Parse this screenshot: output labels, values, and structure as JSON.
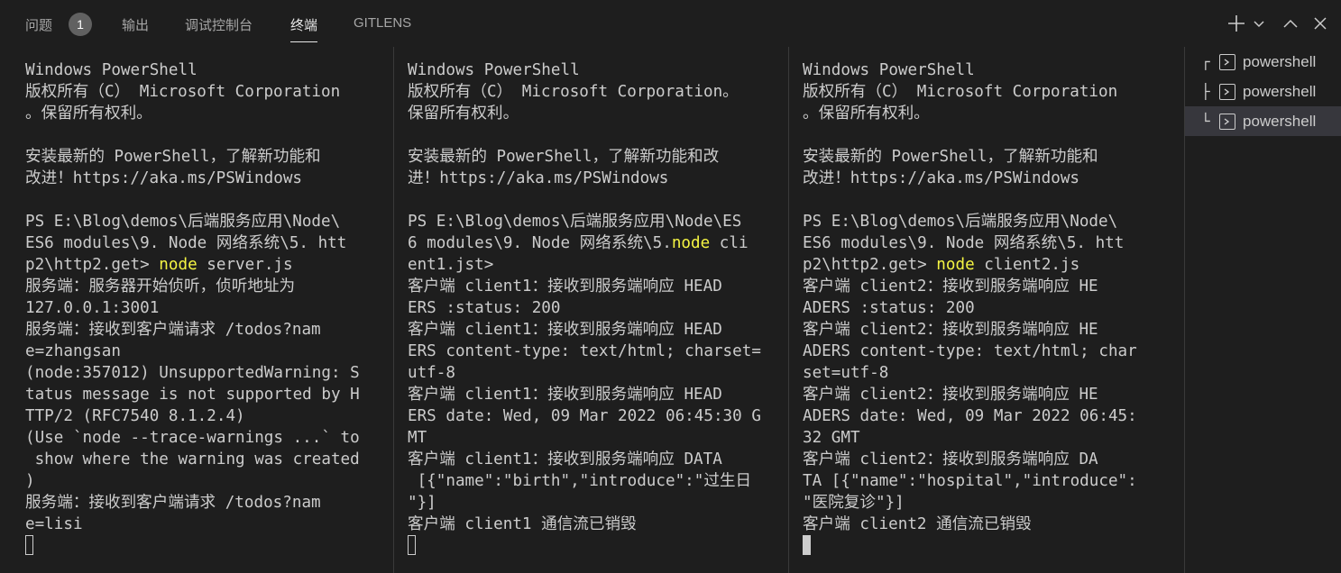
{
  "tabs": [
    {
      "label": "问题",
      "badge": "1"
    },
    {
      "label": "输出"
    },
    {
      "label": "调试控制台"
    },
    {
      "label": "终端",
      "active": true
    },
    {
      "label": "GITLENS"
    }
  ],
  "actions": [
    "plus-icon",
    "chevron-down-icon",
    "chevron-up-icon",
    "close-icon"
  ],
  "terminals": [
    {
      "lines": [
        "Windows PowerShell",
        "版权所有（C） Microsoft Corporation",
        "。保留所有权利。",
        "",
        "安装最新的 PowerShell，了解新功能和",
        "改进！https://aka.ms/PSWindows",
        "",
        "PS E:\\Blog\\demos\\后端服务应用\\Node\\",
        "ES6 modules\\9. Node 网络系统\\5. htt",
        "p2\\http2.get> node server.js",
        "服务端：服务器开始侦听，侦听地址为",
        "127.0.0.1:3001",
        "服务端：接收到客户端请求 /todos?nam",
        "e=zhangsan",
        "(node:357012) UnsupportedWarning: S",
        "tatus message is not supported by H",
        "TTP/2 (RFC7540 8.1.2.4)",
        "(Use `node --trace-warnings ...` to",
        " show where the warning was created",
        ")",
        "服务端：接收到客户端请求 /todos?nam",
        "e=lisi"
      ]
    },
    {
      "lines": [
        "Windows PowerShell",
        "版权所有（C） Microsoft Corporation。",
        "保留所有权利。",
        "",
        "安装最新的 PowerShell，了解新功能和改",
        "进！https://aka.ms/PSWindows",
        "",
        "PS E:\\Blog\\demos\\后端服务应用\\Node\\ES",
        "6 modules\\9. Node 网络系统\\5.node cli",
        "ent1.jst>",
        "客户端 client1：接收到服务端响应 HEAD",
        "ERS :status: 200",
        "客户端 client1：接收到服务端响应 HEAD",
        "ERS content-type: text/html; charset=",
        "utf-8",
        "客户端 client1：接收到服务端响应 HEAD",
        "ERS date: Wed, 09 Mar 2022 06:45:30 G",
        "MT",
        "客户端 client1：接收到服务端响应 DATA",
        " [{\"name\":\"birth\",\"introduce\":\"过生日",
        "\"}]",
        "客户端 client1 通信流已销毁"
      ]
    },
    {
      "lines": [
        "Windows PowerShell",
        "版权所有（C） Microsoft Corporation",
        "。保留所有权利。",
        "",
        "安装最新的 PowerShell，了解新功能和",
        "改进！https://aka.ms/PSWindows",
        "",
        "PS E:\\Blog\\demos\\后端服务应用\\Node\\",
        "ES6 modules\\9. Node 网络系统\\5. htt",
        "p2\\http2.get> node client2.js",
        "客户端 client2：接收到服务端响应 HE",
        "ADERS :status: 200",
        "客户端 client2：接收到服务端响应 HE",
        "ADERS content-type: text/html; char",
        "set=utf-8",
        "客户端 client2：接收到服务端响应 HE",
        "ADERS date: Wed, 09 Mar 2022 06:45:",
        "32 GMT",
        "客户端 client2：接收到服务端响应 DA",
        "TA [{\"name\":\"hospital\",\"introduce\":",
        "\"医院复诊\"}]",
        "客户端 client2 通信流已销毁"
      ]
    }
  ],
  "sidebar": {
    "items": [
      {
        "tree": "┌",
        "label": "powershell"
      },
      {
        "tree": "├",
        "label": "powershell"
      },
      {
        "tree": "└",
        "label": "powershell",
        "selected": true
      }
    ]
  },
  "colors": {
    "background": "#1e1e1e",
    "text": "#cccccc",
    "highlight": "#f5f543",
    "selected": "#37373d"
  }
}
